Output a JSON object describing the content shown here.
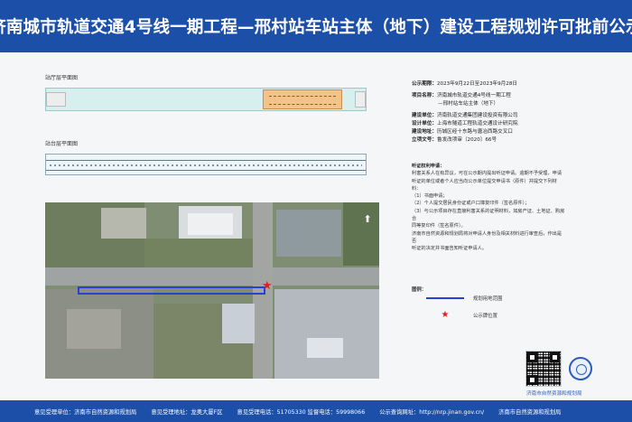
{
  "header": {
    "title": "济南城市轨道交通4号线一期工程—邢村站车站主体（地下）建设工程规划许可批前公示"
  },
  "plans": {
    "hall_label": "站厅层平面图",
    "platform_label": "站台层平面图"
  },
  "info": {
    "publicity_period_key": "公示期限：",
    "publicity_period_value": "2023年9月22日至2023年9月28日",
    "project_name_key": "项目名称：",
    "project_name_value_1": "济南城市轨道交通4号线一期工程",
    "project_name_value_2": "—邢村站车站主体（地下）",
    "builder_key": "建设单位：",
    "builder_value": "济南轨道交通集团建设投资有限公司",
    "designer_key": "设计单位：",
    "designer_value": "上海市隧道工程轨道交通设计研究院",
    "location_key": "建设地址：",
    "location_value": "历城区经十东路与唐冶西路交叉口",
    "approval_key": "立项文号：",
    "approval_value": "鲁发改项审〔2020〕66号"
  },
  "opinion": {
    "title": "听证权利申请：",
    "lines": [
      "利害关系人在有异议，可在公示期内提出听证申请。逾期不予受理，申请",
      "听证的单位或者个人应当向公示单位提交申请书（原件）并提交下列材料：",
      "（1）书面申请；",
      "（2）个人提交居民身份证或户口簿复印件（签名原件）；",
      "（3）与公示项目存在直接利害关系的证明材料，如房产证、土地证、购房合",
      "同等复印件（签名原件）。",
      "济南市自然资源和规划局将对申请人身份及相关材料进行审查后，作出是否",
      "听证的决定并书面告知听证申请人。"
    ]
  },
  "legend": {
    "title": "图例：",
    "boundary_label": "规划用地范围",
    "star_label": "公示牌位置"
  },
  "dept": "济南市自然资源和规划局",
  "footer": {
    "unit": "意见受理单位：济南市自然资源和规划局",
    "address": "意见受理地址：龙奥大厦F区",
    "phone": "意见受理电话：51705330  监督电话：59998066",
    "website": "公示查询网址：http://nrp.jinan.gov.cn/",
    "issuer": "济南市自然资源和规划局"
  },
  "colors": {
    "header_bg": "#1c4fa8",
    "boundary": "#2a3fd4",
    "star": "#e21d1d"
  },
  "icons": {
    "north_arrow": "north-arrow-icon",
    "location_star": "star-icon",
    "qr": "qr-code-icon",
    "seal": "seal-icon"
  }
}
